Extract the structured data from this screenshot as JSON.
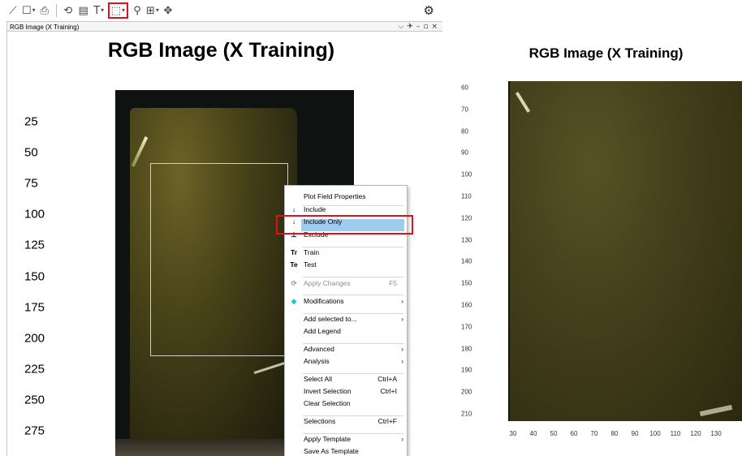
{
  "left_window": {
    "toolbar": {
      "buttons": [
        {
          "icon": "scatter-plot-icon"
        },
        {
          "icon": "window-layout-icon",
          "dropdown": true
        },
        {
          "icon": "print-icon"
        },
        {
          "icon": "history-icon"
        },
        {
          "icon": "plot-properties-icon"
        },
        {
          "icon": "text-icon",
          "dropdown": true
        },
        {
          "icon": "selection-tool-icon",
          "dropdown": true
        },
        {
          "icon": "zoom-icon"
        },
        {
          "icon": "zoom-region-icon",
          "dropdown": true
        },
        {
          "icon": "pan-icon"
        }
      ],
      "settings_icon": "gear-icon"
    },
    "tab_label": "RGB Image (X Training)",
    "window_controls": [
      "⌵",
      "✈",
      "–",
      "▫",
      "×"
    ],
    "plot_title": "RGB Image (X Training)",
    "y_ticks": [
      "25",
      "50",
      "75",
      "100",
      "125",
      "150",
      "175",
      "200",
      "225",
      "250",
      "275"
    ]
  },
  "context_menu": {
    "items": [
      {
        "label": "Plot Field Properties",
        "icon": "",
        "shortcut": "",
        "submenu": false,
        "disabled": false
      },
      {
        "label": "Include",
        "icon": "↓",
        "shortcut": "",
        "submenu": false,
        "disabled": false
      },
      {
        "label": "Include Only",
        "icon": "↓",
        "shortcut": "",
        "submenu": false,
        "disabled": false,
        "highlighted": true
      },
      {
        "label": "Exclude",
        "icon": "⊥",
        "shortcut": "",
        "submenu": false,
        "disabled": false
      },
      {
        "label": "Train",
        "icon": "Tr",
        "shortcut": "",
        "submenu": false,
        "disabled": false
      },
      {
        "label": "Test",
        "icon": "Te",
        "shortcut": "",
        "submenu": false,
        "disabled": false
      },
      {
        "label": "Apply Changes",
        "icon": "⟳",
        "shortcut": "F5",
        "submenu": false,
        "disabled": true
      },
      {
        "label": "Modifications",
        "icon": "◆",
        "shortcut": "",
        "submenu": true,
        "disabled": false
      },
      {
        "label": "Add selected to...",
        "icon": "",
        "shortcut": "",
        "submenu": true,
        "disabled": false
      },
      {
        "label": "Add Legend",
        "icon": "",
        "shortcut": "",
        "submenu": false,
        "disabled": false
      },
      {
        "label": "Advanced",
        "icon": "",
        "shortcut": "",
        "submenu": true,
        "disabled": false
      },
      {
        "label": "Analysis",
        "icon": "",
        "shortcut": "",
        "submenu": true,
        "disabled": false
      },
      {
        "label": "Select All",
        "icon": "",
        "shortcut": "Ctrl+A",
        "submenu": false,
        "disabled": false
      },
      {
        "label": "Invert Selection",
        "icon": "",
        "shortcut": "Ctrl+I",
        "submenu": false,
        "disabled": false
      },
      {
        "label": "Clear Selection",
        "icon": "",
        "shortcut": "",
        "submenu": false,
        "disabled": false
      },
      {
        "label": "Selections",
        "icon": "",
        "shortcut": "Ctrl+F",
        "submenu": false,
        "disabled": false
      },
      {
        "label": "Apply Template",
        "icon": "",
        "shortcut": "",
        "submenu": true,
        "disabled": false
      },
      {
        "label": "Save As Template",
        "icon": "",
        "shortcut": "",
        "submenu": false,
        "disabled": false
      }
    ]
  },
  "right_plot": {
    "title": "RGB Image (X Training)",
    "y_ticks": [
      "60",
      "70",
      "80",
      "90",
      "100",
      "110",
      "120",
      "130",
      "140",
      "150",
      "160",
      "170",
      "180",
      "190",
      "200",
      "210"
    ],
    "x_ticks": [
      "30",
      "40",
      "50",
      "60",
      "70",
      "80",
      "90",
      "100",
      "110",
      "120",
      "130"
    ]
  },
  "colors": {
    "highlight_red": "#e3101a",
    "menu_selected": "#9fccee",
    "modifications_icon": "#1fc4d6"
  }
}
